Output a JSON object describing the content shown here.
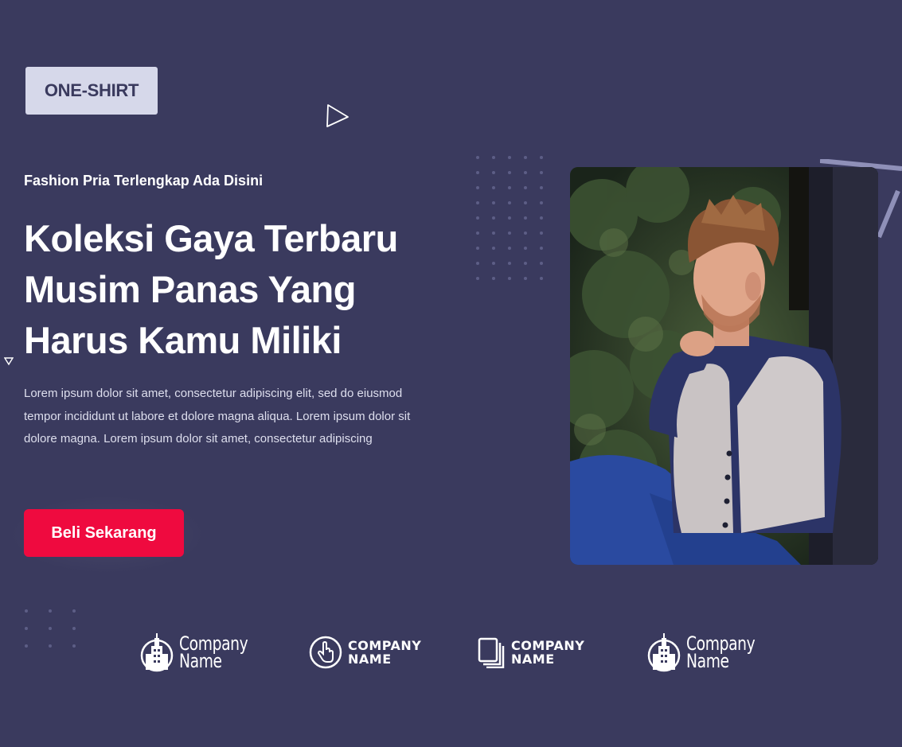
{
  "brand": {
    "logo_text": "ONE-SHIRT"
  },
  "hero": {
    "subtitle": "Fashion Pria Terlengkap Ada Disini",
    "headline": [
      "Koleksi Gaya Terbaru",
      "Musim Panas Yang",
      "Harus Kamu Miliki"
    ],
    "description": [
      "Lorem ipsum dolor sit amet, consectetur adipiscing elit, sed do eiusmod",
      "tempor incididunt ut labore et dolore magna aliqua. Lorem ipsum dolor sit",
      "dolore magna. Lorem ipsum dolor sit amet, consectetur adipiscing"
    ],
    "cta_label": "Beli Sekarang"
  },
  "partners": [
    {
      "icon": "building-icon",
      "line1": "Company",
      "line2": "Name"
    },
    {
      "icon": "hand-pointer-icon",
      "line1": "COMPANY",
      "line2": "NAME"
    },
    {
      "icon": "pages-icon",
      "line1": "COMPANY",
      "line2": "NAME"
    },
    {
      "icon": "building-icon",
      "line1": "Company",
      "line2": "Name"
    }
  ],
  "colors": {
    "background": "#3a3a5e",
    "logo_bg": "#d6d8ea",
    "cta": "#ef0a3f",
    "text": "#ffffff"
  }
}
